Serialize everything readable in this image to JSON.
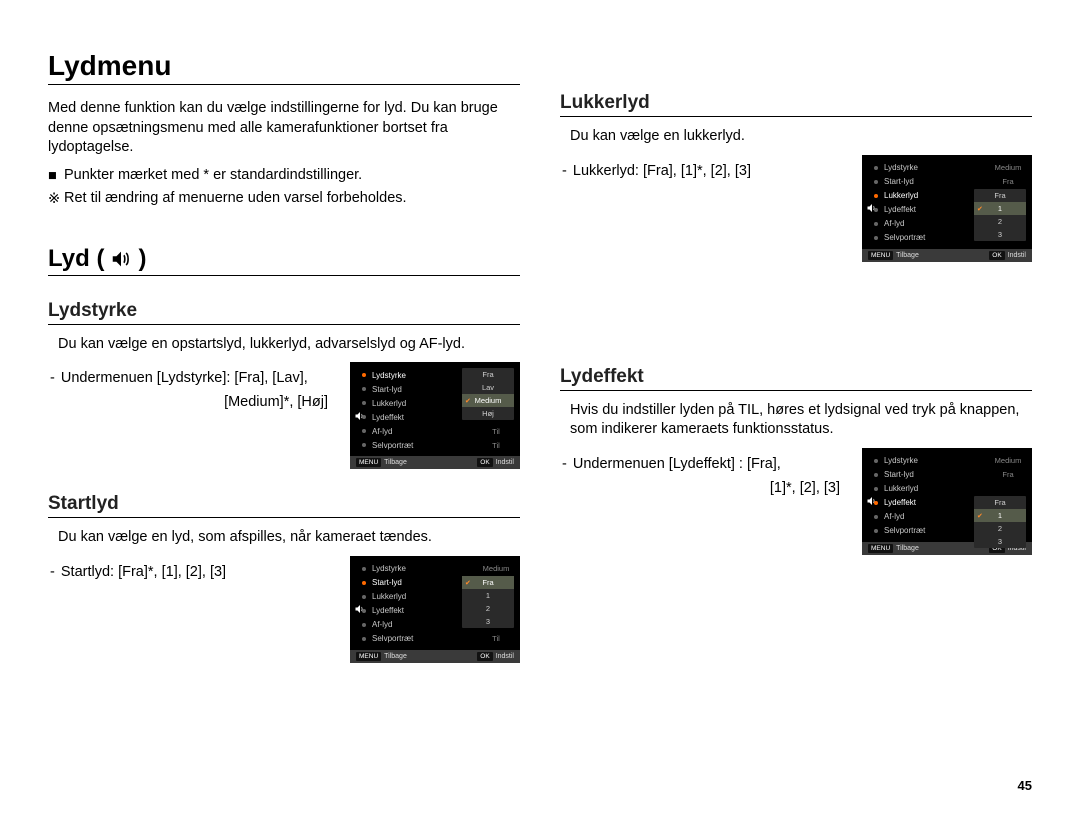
{
  "page": {
    "title": "Lydmenu",
    "number": "45"
  },
  "intro": {
    "para": "Med denne funktion kan du vælge indstillingerne for lyd. Du kan bruge denne opsætningsmenu med alle kamerafunktioner bortset fra lydoptagelse.",
    "bullet1_marker": "■",
    "bullet1": "Punkter mærket med * er standardindstillinger.",
    "bullet2_marker": "※",
    "bullet2": "Ret til ændring af menuerne uden varsel forbeholdes."
  },
  "section_lyd": {
    "title": "Lyd (",
    "title_end": " )"
  },
  "lydstyrke": {
    "title": "Lydstyrke",
    "desc": "Du kan vælge en opstartslyd, lukkerlyd, advarselslyd og AF-lyd.",
    "line1": "Undermenuen [Lydstyrke]: [Fra], [Lav],",
    "line2": "[Medium]*, [Høj]"
  },
  "startlyd": {
    "title": "Startlyd",
    "desc": "Du kan vælge en lyd, som afspilles, når kameraet tændes.",
    "line": "Startlyd: [Fra]*, [1], [2], [3]"
  },
  "lukkerlyd": {
    "title": "Lukkerlyd",
    "desc": "Du kan vælge en lukkerlyd.",
    "line": "Lukkerlyd: [Fra], [1]*, [2], [3]"
  },
  "lydeffekt": {
    "title": "Lydeffekt",
    "desc": "Hvis du indstiller lyden på TIL, høres et lydsignal ved tryk på knappen, som indikerer kameraets funktionsstatus.",
    "line1": "Undermenuen [Lydeffekt] : [Fra],",
    "line2": "[1]*, [2], [3]"
  },
  "screen_common": {
    "items": {
      "lydstyrke": "Lydstyrke",
      "startlyd": "Start-lyd",
      "lukkerlyd": "Lukkerlyd",
      "lydeffekt": "Lydeffekt",
      "aflyd": "Af-lyd",
      "selvportraet": "Selvportræt"
    },
    "val_medium": "Medium",
    "val_fra": "Fra",
    "val_til": "Til",
    "footer_back_btn": "MENU",
    "footer_back": "Tilbage",
    "footer_ok_btn": "OK",
    "footer_ok": "Indstil"
  },
  "screen1_opts": {
    "o1": "Fra",
    "o2": "Lav",
    "o3": "Medium",
    "o4": "Høj"
  },
  "screen2_opts": {
    "o1": "Fra",
    "o2": "1",
    "o3": "2",
    "o4": "3"
  },
  "screen3_opts": {
    "o1": "Fra",
    "o2": "1",
    "o3": "2",
    "o4": "3"
  },
  "screen4_opts": {
    "o1": "Fra",
    "o2": "1",
    "o3": "2",
    "o4": "3"
  }
}
